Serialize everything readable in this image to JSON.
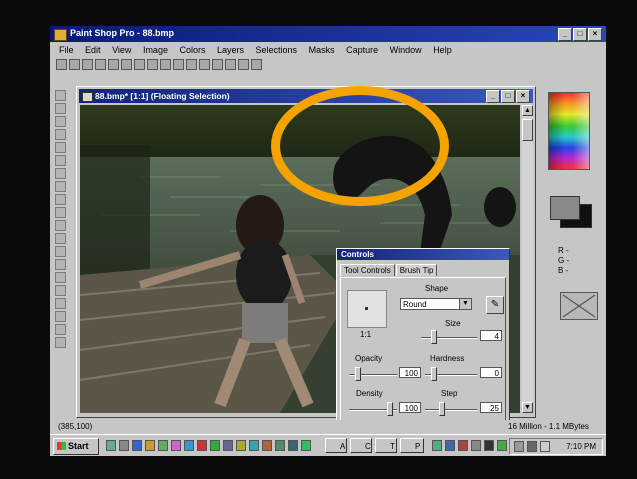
{
  "app": {
    "title": "Paint Shop Pro - 88.bmp"
  },
  "menu": [
    "File",
    "Edit",
    "View",
    "Image",
    "Colors",
    "Layers",
    "Selections",
    "Masks",
    "Capture",
    "Window",
    "Help"
  ],
  "document": {
    "title": "88.bmp* [1:1] (Floating Selection)"
  },
  "palette": {
    "rgb_labels": [
      "R -",
      "G -",
      "B -"
    ],
    "foreground_color": "#8a8a8a",
    "background_color": "#111111"
  },
  "controls": {
    "title": "Controls",
    "tabs": [
      "Tool Controls",
      "Brush Tip"
    ],
    "active_tab": "Brush Tip",
    "preview_label": "1:1",
    "shape_label": "Shape",
    "shape_value": "Round",
    "size_label": "Size",
    "size_value": "4",
    "opacity_label": "Opacity",
    "opacity_value": "100",
    "hardness_label": "Hardness",
    "hardness_value": "0",
    "density_label": "Density",
    "density_value": "100",
    "step_label": "Step",
    "step_value": "25"
  },
  "status": {
    "coords": "(385,100)",
    "info": "16 Million - 1.1 MBytes"
  },
  "taskbar": {
    "start_label": "Start",
    "clock": "7:10 PM",
    "buttons": [
      "A",
      "C",
      "T",
      "P"
    ]
  },
  "accent": "#f5a300"
}
